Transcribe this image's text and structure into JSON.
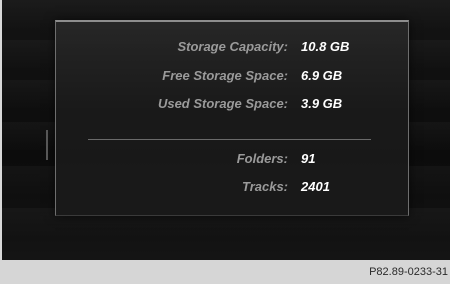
{
  "storage_dialog": {
    "rows": [
      {
        "label": "Storage Capacity:",
        "value": "10.8 GB"
      },
      {
        "label": "Free Storage Space:",
        "value": "6.9 GB"
      },
      {
        "label": "Used Storage Space:",
        "value": "3.9 GB"
      },
      {
        "label": "Folders:",
        "value": "91"
      },
      {
        "label": "Tracks:",
        "value": "2401"
      }
    ]
  },
  "footer": {
    "figure_ref": "P82.89-0233-31"
  }
}
